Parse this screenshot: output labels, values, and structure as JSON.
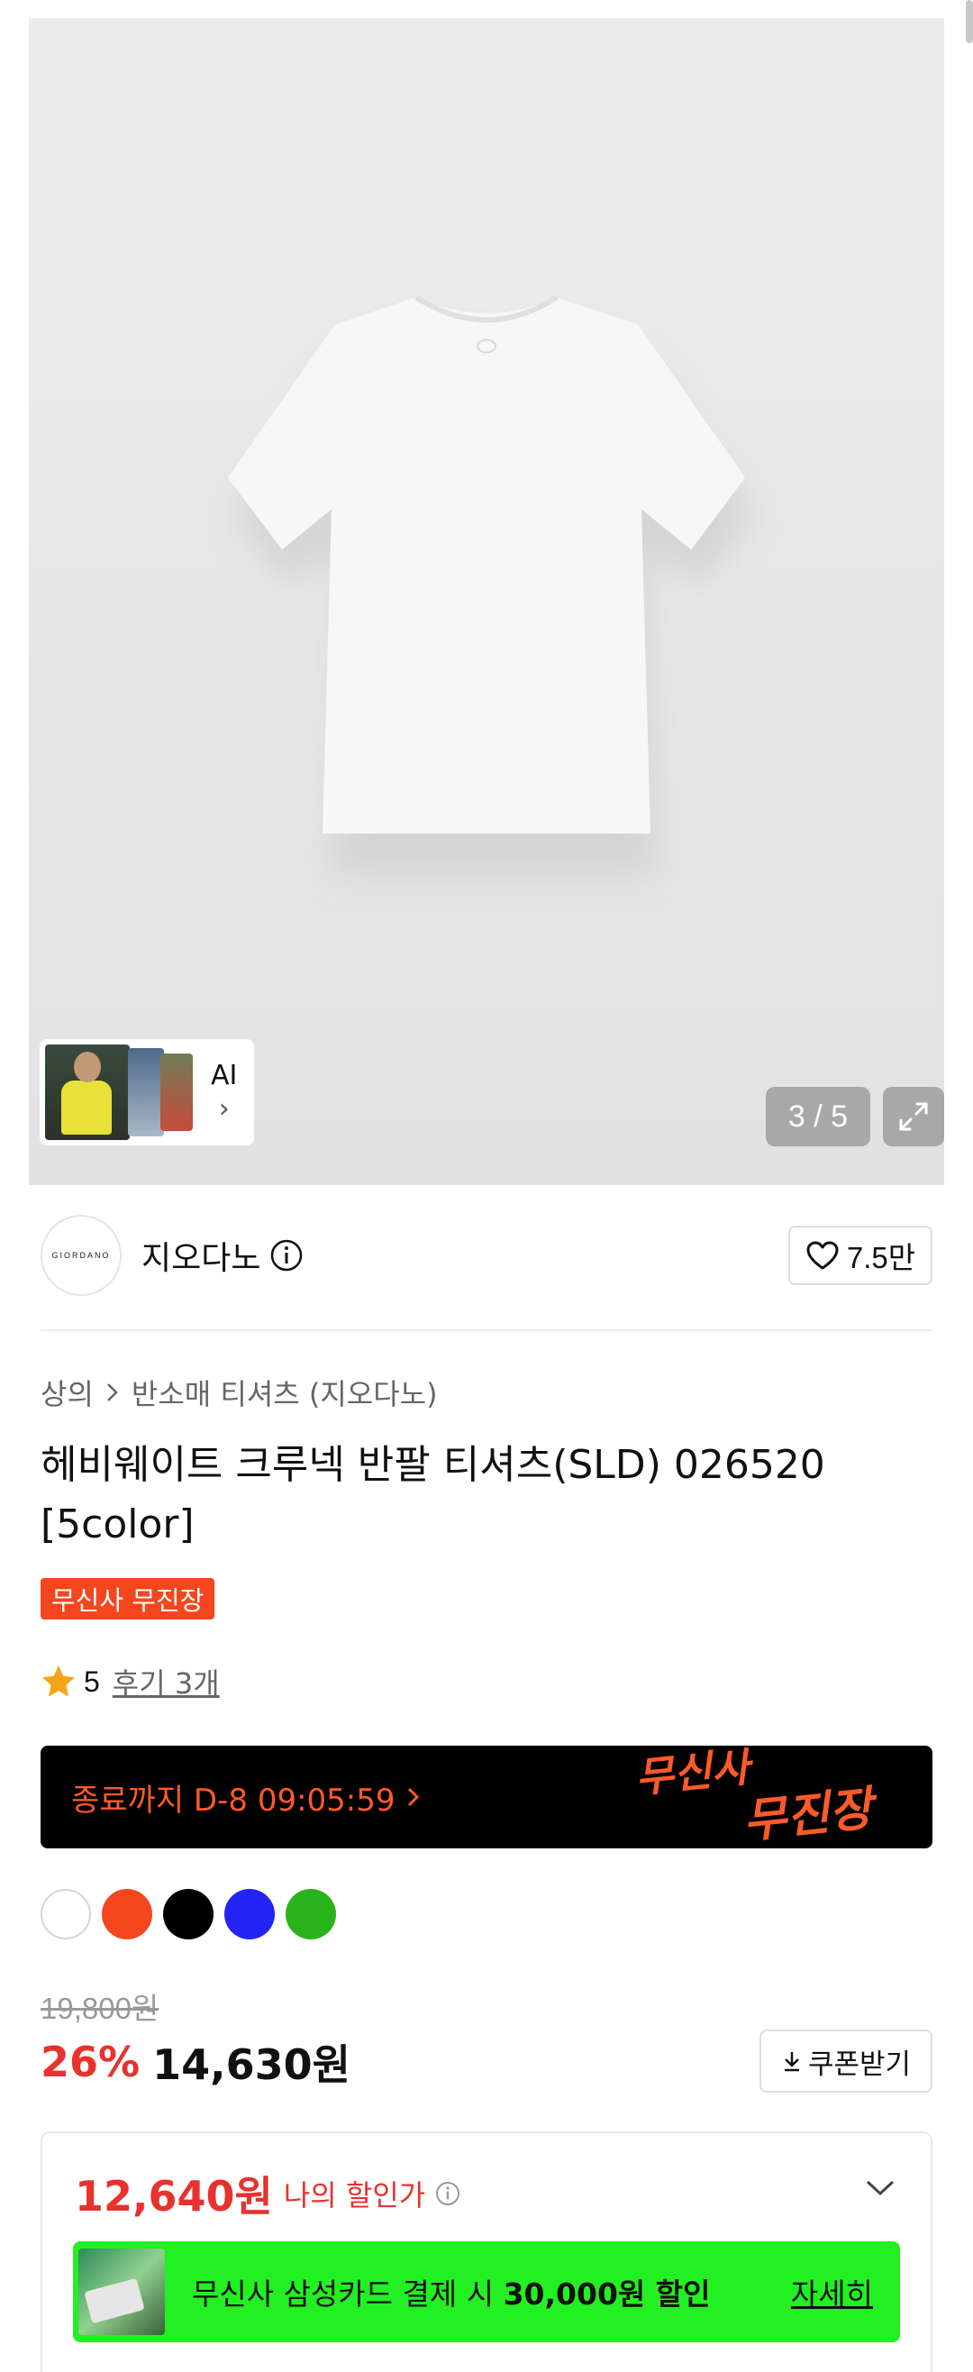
{
  "hero": {
    "ai_label": "AI",
    "counter": "3 / 5"
  },
  "brand": {
    "logo_text": "GIORDANO",
    "name": "지오다노",
    "likes": "7.5만"
  },
  "breadcrumb": {
    "category": "상의",
    "subcategory": "반소매 티셔츠 (지오다노)"
  },
  "product": {
    "title": "헤비웨이트 크루넥 반팔 티셔츠(SLD) 026520 [5color]",
    "tag": "무신사 무진장",
    "rating": "5",
    "reviews": "후기 3개"
  },
  "banner": {
    "text": "종료까지 D-8 09:05:59",
    "logo_line1": "무신사",
    "logo_line2": "무진장"
  },
  "colors": [
    "#ffffff",
    "#f5461e",
    "#000000",
    "#2323f5",
    "#2ab21a"
  ],
  "price": {
    "original": "19,800원",
    "discount": "26%",
    "current": "14,630원",
    "coupon_label": "쿠폰받기"
  },
  "my_discount": {
    "price": "12,640원",
    "label": "나의 할인가",
    "card_text": "무신사 삼성카드 결제 시 ",
    "card_bold": "30,000원 할인",
    "detail": "자세히"
  }
}
